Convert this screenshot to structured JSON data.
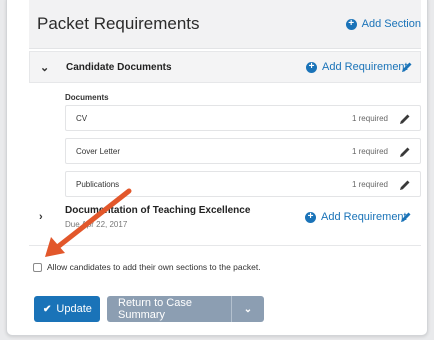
{
  "header": {
    "title": "Packet Requirements",
    "add_section": "Add Section"
  },
  "sections": [
    {
      "title": "Candidate Documents",
      "add_requirement": "Add Requirement"
    },
    {
      "title": "Documentation of Teaching Excellence",
      "date": "Due Apr 22, 2017",
      "add_requirement": "Add Requirement"
    }
  ],
  "documents": {
    "label": "Documents",
    "items": [
      {
        "name": "CV",
        "required": "1 required"
      },
      {
        "name": "Cover Letter",
        "required": "1 required"
      },
      {
        "name": "Publications",
        "required": "1 required"
      }
    ]
  },
  "options": {
    "allow_sections_label": "Allow candidates to add their own sections to the packet."
  },
  "actions": {
    "update_label": "Update",
    "return_label": "Return to Case Summary"
  },
  "colors": {
    "accent": "#1a73b8",
    "secondary_button": "#8c9eb2",
    "annotation_arrow": "#e2572b"
  },
  "icons": {
    "add": "plus-circle-icon",
    "edit": "pencil-icon",
    "expand": "chevron-down-icon",
    "collapse": "chevron-right-icon",
    "dropdown": "chevron-down-icon",
    "confirm": "check-icon"
  }
}
